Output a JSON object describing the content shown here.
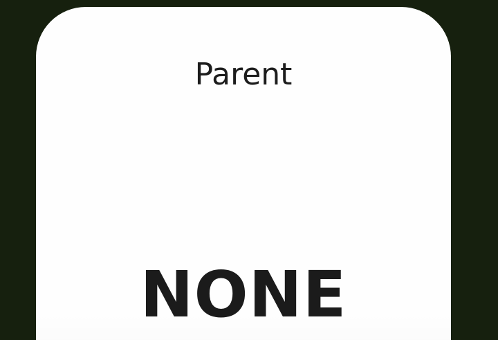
{
  "card": {
    "title": "Parent",
    "value": "NONE"
  },
  "colors": {
    "background": "#16200e",
    "card": "#fefefe",
    "text": "#1c1c1c"
  }
}
